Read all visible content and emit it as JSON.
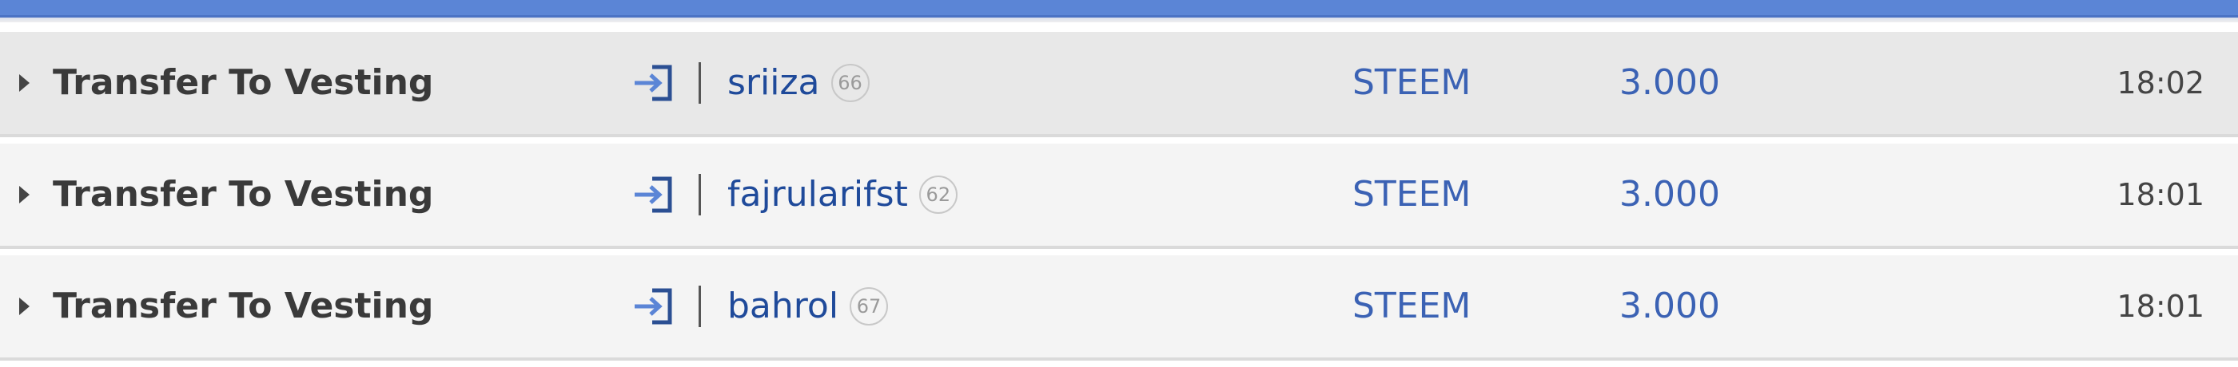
{
  "header": {
    "accent_color": "#5b85d6"
  },
  "operations": [
    {
      "type": "Transfer To Vesting",
      "icon": "login-icon",
      "account": "sriiza",
      "reputation": "66",
      "currency": "STEEM",
      "amount": "3.000",
      "time": "18:02"
    },
    {
      "type": "Transfer To Vesting",
      "icon": "login-icon",
      "account": "fajrularifst",
      "reputation": "62",
      "currency": "STEEM",
      "amount": "3.000",
      "time": "18:01"
    },
    {
      "type": "Transfer To Vesting",
      "icon": "login-icon",
      "account": "bahrol",
      "reputation": "67",
      "currency": "STEEM",
      "amount": "3.000",
      "time": "18:01"
    }
  ]
}
